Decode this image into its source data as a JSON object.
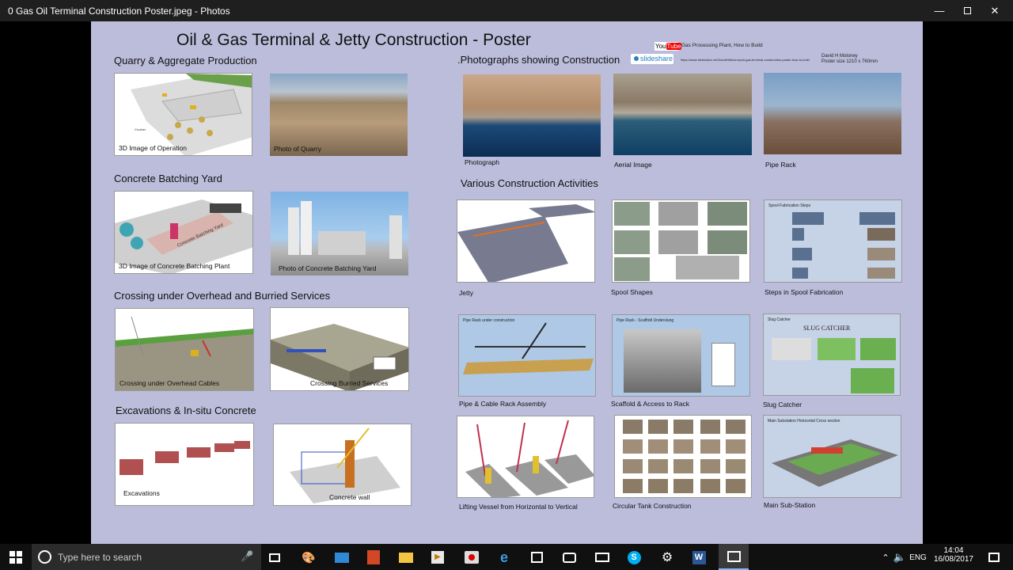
{
  "window": {
    "title": "0 Gas Oil Terminal Construction Poster.jpeg - Photos"
  },
  "poster": {
    "title": "Oil & Gas Terminal & Jetty Construction - Poster",
    "youtube_text": "Gas Processing Plant, How to Build",
    "author": "David H Moloney",
    "size": "Poster size 1210 x 760mm",
    "link_small": "https://www.slideshare.net/DavidHMoloney/oil-gas-terminal-construction-poster-how-to-build",
    "sections": {
      "quarry": "Quarry & Aggregate Production",
      "batching": "Concrete Batching Yard",
      "crossing": "Crossing under Overhead and Burried Services",
      "excavations": "Excavations & In-situ Concrete",
      "photographs": ".Photographs showing Construction",
      "activities": "Various Construction Activities"
    },
    "captions": {
      "quarry3d": "3D Image of Operation",
      "quarryphoto": "Photo of Quarry",
      "batching3d": "3D Image of Concrete Batching Plant",
      "batchingphoto": "Photo of Concrete Batching Yard",
      "overhead": "Crossing under Overhead Cables",
      "burried": "Crossing Burried Services",
      "excavations": "Excavations",
      "concretewall": "Concrete wall",
      "photograph": "Photograph",
      "aerial": "Aerial Image",
      "piperack": "Pipe Rack",
      "jetty": "Jetty",
      "spool": "Spool Shapes",
      "spoolsteps": "Steps in Spool Fabrication",
      "cablerack": "Pipe & Cable Rack Assembly",
      "scaffold": "Scaffold & Access to Rack",
      "slug": "Slug Catcher",
      "lifting": "Lifting Vessel from Horizontal to Vertical",
      "tank": "Circular Tank Construction",
      "substation": "Main Sub-Station"
    },
    "inner": {
      "spoolfab": "Spool Fabrication Steps",
      "piperackuc": "Pipe Rack under construction",
      "scaffoldund": "Pipe Rack - Scaffold Underslung",
      "slugcatcher": "Slug Catcher",
      "slugtitle": "SLUG CATCHER",
      "mainsub": "Main Substation  Horizontal Cross section",
      "crusher": "Crusher",
      "batchingyard": "Concrete Batching Yard"
    }
  },
  "taskbar": {
    "search_placeholder": "Type here to search",
    "lang": "ENG",
    "time": "14:04",
    "date": "16/08/2017"
  }
}
